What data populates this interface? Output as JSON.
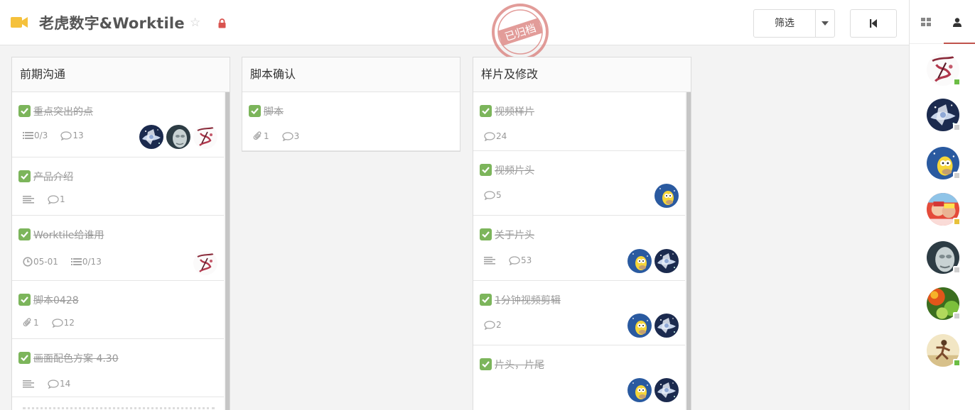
{
  "header": {
    "project_title": "老虎数字&Worktile",
    "stamp_text": "已归档",
    "filter_label": "筛选"
  },
  "colors": {
    "accent": "#c0534c",
    "checkbox": "#7cb55b",
    "camera": "#f5c13b",
    "lock": "#d9534f",
    "online": "#6cbd45",
    "away": "#e8c23b",
    "offline": "#cfcfcf"
  },
  "lists": [
    {
      "title": "前期沟通",
      "cards": [
        {
          "title": "重点突出的点",
          "meta": [
            {
              "icon": "checklist-icon",
              "text": "0/3"
            },
            {
              "icon": "comment-icon",
              "text": "13"
            }
          ],
          "avatars": [
            "galaxy",
            "grey-face",
            "ink-art"
          ]
        },
        {
          "title": "产品介绍",
          "meta": [
            {
              "icon": "description-icon",
              "text": ""
            },
            {
              "icon": "comment-icon",
              "text": "1"
            }
          ],
          "avatars": []
        },
        {
          "title": "Worktile给谁用",
          "meta": [
            {
              "icon": "clock-icon",
              "text": "05-01"
            },
            {
              "icon": "checklist-icon",
              "text": "0/13"
            }
          ],
          "avatars": [
            "ink-art"
          ]
        },
        {
          "title": "脚本0428",
          "meta": [
            {
              "icon": "attachment-icon",
              "text": "1"
            },
            {
              "icon": "comment-icon",
              "text": "12"
            }
          ],
          "avatars": []
        },
        {
          "title": "画面配色方案 4.30",
          "meta": [
            {
              "icon": "description-icon",
              "text": ""
            },
            {
              "icon": "comment-icon",
              "text": "14"
            }
          ],
          "avatars": []
        }
      ]
    },
    {
      "title": "脚本确认",
      "cards": [
        {
          "title": "脚本",
          "meta": [
            {
              "icon": "attachment-icon",
              "text": "1"
            },
            {
              "icon": "comment-icon",
              "text": "3"
            }
          ],
          "avatars": []
        }
      ]
    },
    {
      "title": "样片及修改",
      "cards": [
        {
          "title": "视频样片",
          "meta": [
            {
              "icon": "comment-icon",
              "text": "24"
            }
          ],
          "avatars": []
        },
        {
          "title": "视频片头",
          "meta": [
            {
              "icon": "comment-icon",
              "text": "5"
            }
          ],
          "avatars": [
            "cartoon"
          ]
        },
        {
          "title": "关于片头",
          "meta": [
            {
              "icon": "description-icon",
              "text": ""
            },
            {
              "icon": "comment-icon",
              "text": "53"
            }
          ],
          "avatars": [
            "cartoon",
            "galaxy"
          ]
        },
        {
          "title": "1分钟视频剪辑",
          "meta": [
            {
              "icon": "comment-icon",
              "text": "2"
            }
          ],
          "avatars": [
            "cartoon",
            "galaxy"
          ]
        },
        {
          "title": "片头，片尾",
          "meta": [],
          "avatars": [
            "cartoon",
            "galaxy"
          ]
        }
      ]
    }
  ],
  "members": [
    {
      "avatar": "ink-art",
      "status": "online"
    },
    {
      "avatar": "galaxy",
      "status": "offline"
    },
    {
      "avatar": "cartoon",
      "status": "offline"
    },
    {
      "avatar": "photo-red",
      "status": "away"
    },
    {
      "avatar": "grey-face",
      "status": "offline"
    },
    {
      "avatar": "flower",
      "status": "offline"
    },
    {
      "avatar": "runner",
      "status": "online"
    }
  ]
}
